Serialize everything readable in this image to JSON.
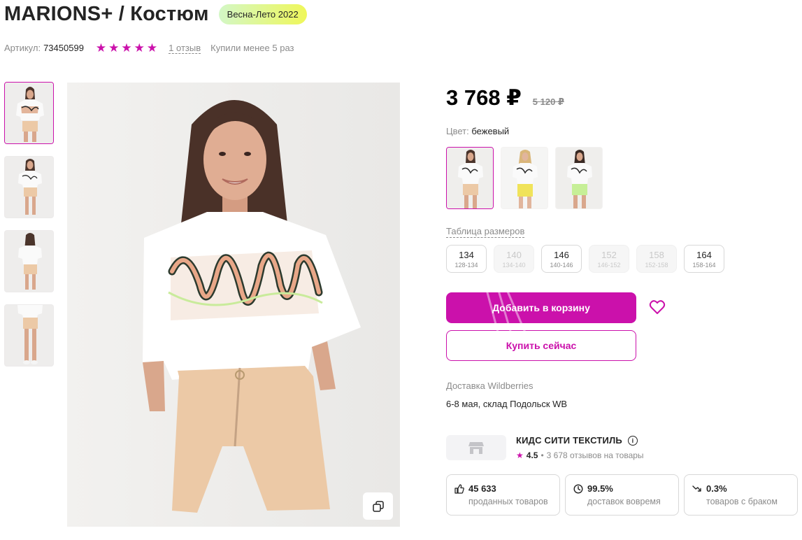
{
  "product": {
    "title": "MARIONS+ / Костюм",
    "season_badge": "Весна-Лето 2022",
    "sku_label": "Артикул:",
    "sku_value": "73450599",
    "rating": 5,
    "reviews_link": "1 отзыв",
    "purchases_text": "Купили менее 5 раз"
  },
  "gallery": {
    "thumbnail_count": 4,
    "active_index": 0
  },
  "pricing": {
    "price": "3 768 ₽",
    "old_price": "5 120 ₽"
  },
  "color": {
    "label": "Цвет:",
    "value": "бежевый",
    "options": [
      {
        "name": "бежевый",
        "shorts_color": "#ecc9a6"
      },
      {
        "name": "жёлтый",
        "shorts_color": "#f0e35a"
      },
      {
        "name": "салатовый",
        "shorts_color": "#c6ef97"
      }
    ]
  },
  "sizes": {
    "table_link": "Таблица размеров",
    "items": [
      {
        "size": "134",
        "range": "128-134",
        "available": true
      },
      {
        "size": "140",
        "range": "134-140",
        "available": false
      },
      {
        "size": "146",
        "range": "140-146",
        "available": true
      },
      {
        "size": "152",
        "range": "146-152",
        "available": false
      },
      {
        "size": "158",
        "range": "152-158",
        "available": false
      },
      {
        "size": "164",
        "range": "158-164",
        "available": true
      }
    ]
  },
  "actions": {
    "add_to_cart": "Добавить в корзину",
    "buy_now": "Купить сейчас"
  },
  "delivery": {
    "label": "Доставка Wildberries",
    "value": "6-8 мая, склад Подольск WB"
  },
  "seller": {
    "name": "КИДС СИТИ ТЕКСТИЛЬ",
    "info_icon": "i",
    "rating": "4.5",
    "reviews": "3 678 отзывов на товары"
  },
  "stats": [
    {
      "value": "45 633",
      "label": "проданных товаров",
      "icon": "thumbs-up-icon"
    },
    {
      "value": "99.5%",
      "label": "доставок вовремя",
      "icon": "clock-icon"
    },
    {
      "value": "0.3%",
      "label": "товаров с браком",
      "icon": "trend-down-icon"
    }
  ],
  "colors": {
    "accent": "#cb11ab",
    "text": "#242424",
    "muted": "#8b8b8b"
  }
}
